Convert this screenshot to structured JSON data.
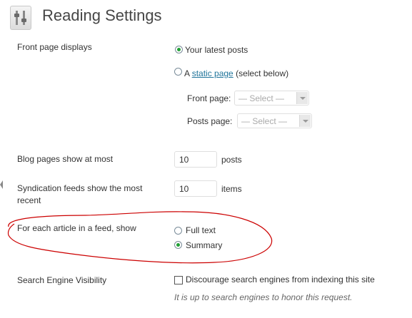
{
  "page": {
    "title": "Reading Settings"
  },
  "front_page": {
    "label": "Front page displays",
    "option_latest": "Your latest posts",
    "option_static_prefix": "A",
    "option_static_link": "static page",
    "option_static_suffix": "(select below)",
    "front_page_label": "Front page:",
    "front_page_value": "— Select —",
    "posts_page_label": "Posts page:",
    "posts_page_value": "— Select —",
    "selected": "latest"
  },
  "blog_pages": {
    "label": "Blog pages show at most",
    "value": "10",
    "unit": "posts"
  },
  "syndication": {
    "label_line1": "Syndication feeds show the most",
    "label_line2": "recent",
    "value": "10",
    "unit": "items"
  },
  "feed_article": {
    "label": "For each article in a feed, show",
    "option_full": "Full text",
    "option_summary": "Summary",
    "selected": "summary",
    "annotation_color": "#cc0000"
  },
  "search_engine": {
    "label": "Search Engine Visibility",
    "checkbox_label": "Discourage search engines from indexing this site",
    "checked": false,
    "description": "It is up to search engines to honor this request."
  },
  "colors": {
    "link": "#21759b",
    "radio_checked": "#21a035",
    "title": "#464646"
  }
}
